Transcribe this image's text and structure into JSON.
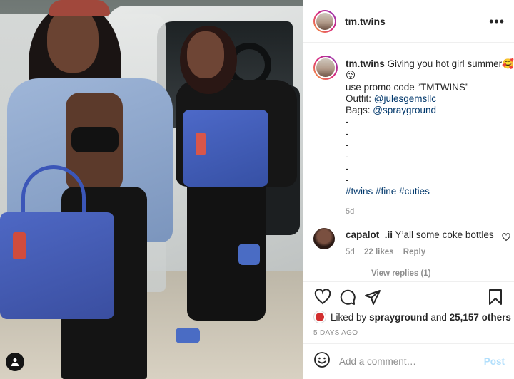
{
  "post": {
    "username": "tm.twins",
    "caption": {
      "username": "tm.twins",
      "first_line": "Giving you hot girl summer🥰",
      "emoji_line": "😜",
      "promo_line": "use promo code “TMTWINS”",
      "outfit_label": "Outfit:",
      "outfit_handle": "@julesgemsllc",
      "bags_label": "Bags:",
      "bags_handle": "@sprayground",
      "dashes": [
        "-",
        "-",
        "-",
        "-",
        "-",
        "-"
      ],
      "hashtags": [
        "#twins",
        "#fine",
        "#cuties"
      ],
      "time": "5d"
    },
    "comment": {
      "username": "capalot_.ii",
      "text": "Y’all some coke bottles",
      "time": "5d",
      "likes": "22 likes",
      "reply": "Reply"
    },
    "view_replies": "View replies (1)",
    "liked_by": {
      "prefix": "Liked by",
      "user": "sprayground",
      "and": "and",
      "others": "25,157 others"
    },
    "timestamp": "5 DAYS AGO"
  },
  "comment_box": {
    "placeholder": "Add a comment…",
    "post_label": "Post"
  },
  "icons": {
    "more": "more-options-icon",
    "like": "heart-icon",
    "comment": "comment-icon",
    "share": "share-icon",
    "save": "bookmark-icon",
    "emoji": "emoji-icon",
    "user_tag": "user-tag-icon"
  },
  "colors": {
    "link": "#00376b",
    "muted": "#8e8e8e",
    "post_button_disabled": "#b2dffc"
  }
}
